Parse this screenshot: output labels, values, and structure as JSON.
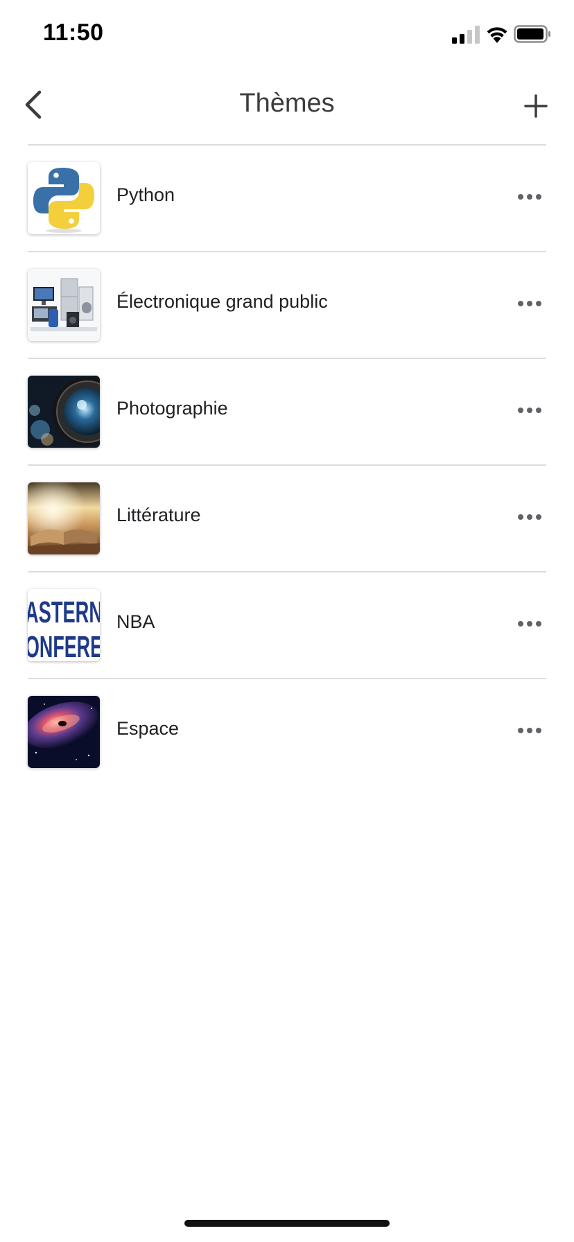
{
  "status_bar": {
    "time": "11:50",
    "icons": [
      "signal-icon",
      "wifi-icon",
      "battery-icon"
    ]
  },
  "header": {
    "title": "Thèmes",
    "back_icon": "chevron-left-icon",
    "add_icon": "plus-icon"
  },
  "topics": [
    {
      "label": "Python",
      "thumbnail": "python-logo-thumbnail"
    },
    {
      "label": "Électronique grand public",
      "thumbnail": "electronics-thumbnail"
    },
    {
      "label": "Photographie",
      "thumbnail": "camera-lens-thumbnail"
    },
    {
      "label": "Littérature",
      "thumbnail": "open-book-thumbnail"
    },
    {
      "label": "NBA",
      "thumbnail": "eastern-conference-thumbnail",
      "thumbnail_text": [
        "ASTERN",
        "ONFERE"
      ]
    },
    {
      "label": "Espace",
      "thumbnail": "galaxy-thumbnail"
    }
  ],
  "colors": {
    "divider": "#dadce0",
    "title": "#3c3c3c",
    "nba_blue": "#1f3a8a"
  }
}
